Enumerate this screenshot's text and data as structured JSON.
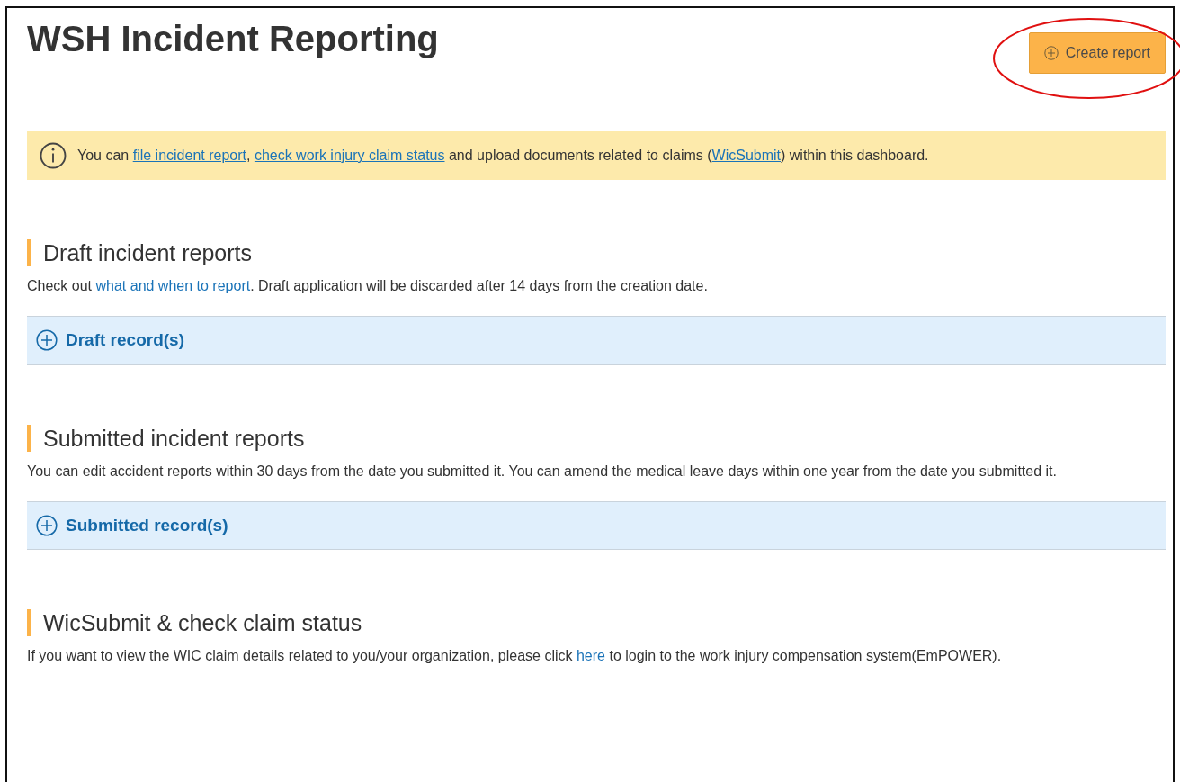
{
  "page": {
    "title": "WSH Incident Reporting"
  },
  "create_button": {
    "label": "Create report",
    "highlighted": true
  },
  "notice": [
    {
      "kind": "text",
      "text": "You can "
    },
    {
      "kind": "link",
      "text": "file incident report"
    },
    {
      "kind": "text",
      "text": ", "
    },
    {
      "kind": "link",
      "text": "check work injury claim status"
    },
    {
      "kind": "text",
      "text": " and upload documents related to claims ("
    },
    {
      "kind": "link",
      "text": "WicSubmit"
    },
    {
      "kind": "text",
      "text": ") within this dashboard."
    }
  ],
  "sections": [
    {
      "heading": "Draft incident reports",
      "description": [
        {
          "kind": "text",
          "text": "Check out "
        },
        {
          "kind": "plainlink",
          "text": "what and when to report"
        },
        {
          "kind": "text",
          "text": ". Draft application will be discarded after 14 days from the creation date."
        }
      ],
      "accordion": {
        "label": "Draft record(s)",
        "expanded": false
      }
    },
    {
      "heading": "Submitted incident reports",
      "description": [
        {
          "kind": "text",
          "text": "You can edit accident reports within 30 days from the date you submitted it. You can amend the medical leave days within one year from the date you submitted it."
        }
      ],
      "accordion": {
        "label": "Submitted record(s)",
        "expanded": false
      }
    },
    {
      "heading": "WicSubmit & check claim status",
      "description": [
        {
          "kind": "text",
          "text": "If you want to view the WIC claim details related to you/your organization, please click "
        },
        {
          "kind": "plainlink",
          "text": "here"
        },
        {
          "kind": "text",
          "text": " to login to the work injury compensation system(EmPOWER)."
        }
      ]
    }
  ]
}
